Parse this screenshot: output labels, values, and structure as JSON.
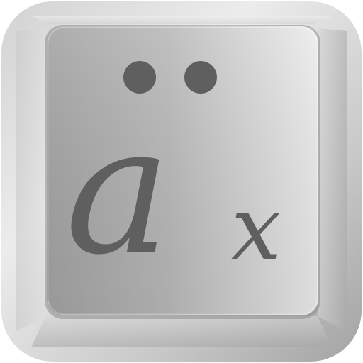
{
  "app_icon": {
    "logo_text": "äx",
    "icon_name": "umlaut-a-keycap-icon",
    "colors": {
      "frame_light": "#e6e6e6",
      "frame_dark": "#9a9a9a",
      "key_face_light": "#f0f0f0",
      "key_face_dark": "#a7a7a7",
      "glyph": "#5f5f5f"
    }
  }
}
